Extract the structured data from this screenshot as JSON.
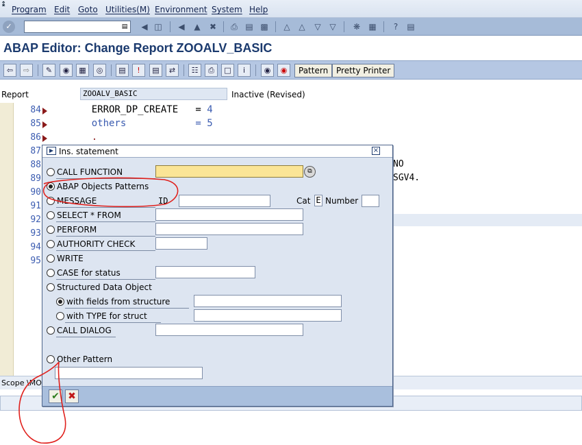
{
  "menu": {
    "items": [
      "Program",
      "Edit",
      "Goto",
      "Utilities(M)",
      "Environment",
      "System",
      "Help"
    ]
  },
  "toolbar": {
    "command_value": "",
    "icons": [
      "enter-icon",
      "back-icon",
      "exit-icon",
      "cancel-icon",
      "print-icon",
      "find-icon",
      "find-next-icon",
      "first-page-icon",
      "previous-page-icon",
      "next-page-icon",
      "last-page-icon",
      "new-session-icon",
      "shortcut-icon",
      "help-icon",
      "layout-icon"
    ]
  },
  "title": "ABAP Editor: Change Report ZOOALV_BASIC",
  "app_toolbar": {
    "pattern_label": "Pattern",
    "pretty_printer_label": "Pretty Printer"
  },
  "report": {
    "label": "Report",
    "value": "ZOOALV_BASIC",
    "status": "Inactive (Revised)"
  },
  "editor": {
    "line_numbers": [
      "84",
      "85",
      "86",
      "87",
      "88",
      "89",
      "90",
      "91",
      "92",
      "93",
      "94",
      "95"
    ],
    "lines": [
      {
        "text": "    ERROR_DP_CREATE   = ",
        "num": "4"
      },
      {
        "text": "    others            = ",
        "num": "5"
      },
      {
        "text": "    .",
        "num": ""
      }
    ],
    "fragments": [
      "NO",
      "SGV4."
    ],
    "scope_text": "Scope \\MO"
  },
  "dialog": {
    "title": "Ins. statement",
    "options": {
      "call_function": "CALL FUNCTION",
      "abap_objects": "ABAP Objects Patterns",
      "message": "MESSAGE",
      "select": "SELECT * FROM",
      "perform": "PERFORM",
      "authority": "AUTHORITY CHECK",
      "write": "WRITE",
      "case": "CASE for status",
      "structured": "Structured Data Object",
      "with_fields": "with fields from structure",
      "with_type": "with TYPE for struct",
      "call_dialog": "CALL DIALOG",
      "other": "Other Pattern"
    },
    "message_id_label": "ID",
    "cat_label": "Cat",
    "cat_value": "E",
    "number_label": "Number"
  },
  "colors": {
    "title": "#1b3a6e",
    "required_field": "#fbe596",
    "annotation": "#e0201c",
    "dialog_bg": "#dde5f1"
  }
}
